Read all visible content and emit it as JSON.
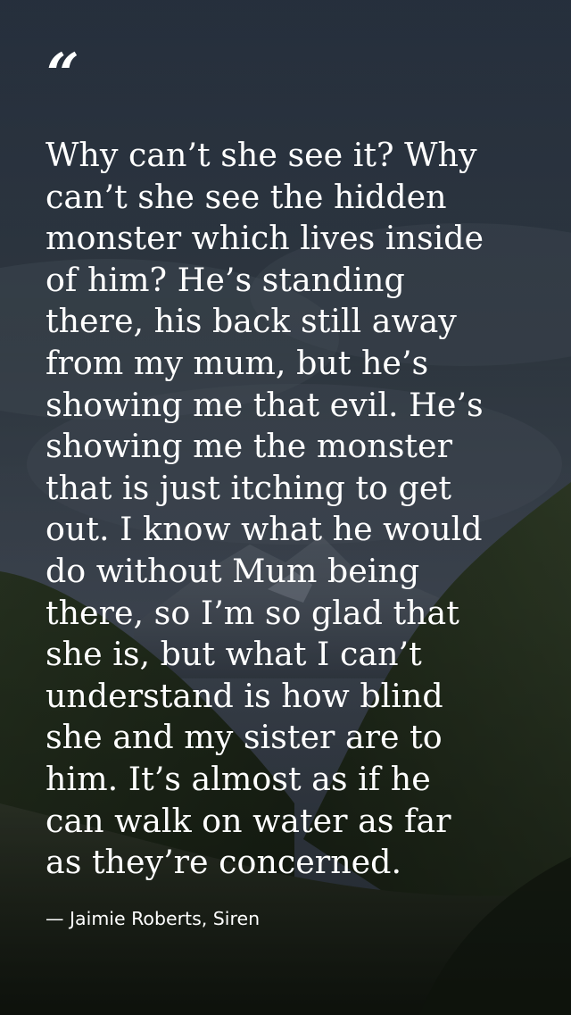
{
  "quote": {
    "mark": "“",
    "text": "Why can’t she see it? Why\ncan’t she see the hidden\nmonster which lives inside\nof him? He’s standing\nthere, his back still away\nfrom my mum, but he’s\nshowing me that evil. He’s\nshowing me the monster\nthat is just itching to get\nout. I know what he would\ndo without Mum being\nthere, so I’m so glad that\nshe is, but what I can’t\nunderstand is how blind\nshe and my sister are to\nhim. It’s almost as if he\ncan walk on water as far\nas they’re concerned.",
    "attribution": "— Jaimie Roberts, Siren"
  },
  "colors": {
    "text": "#ffffff",
    "sky_top": "#2f3a4b",
    "sky_bottom": "#4a5566",
    "mountain_far": "#5b6676",
    "mountain_mid": "#2b3628",
    "mountain_near": "#1f2a1c"
  }
}
